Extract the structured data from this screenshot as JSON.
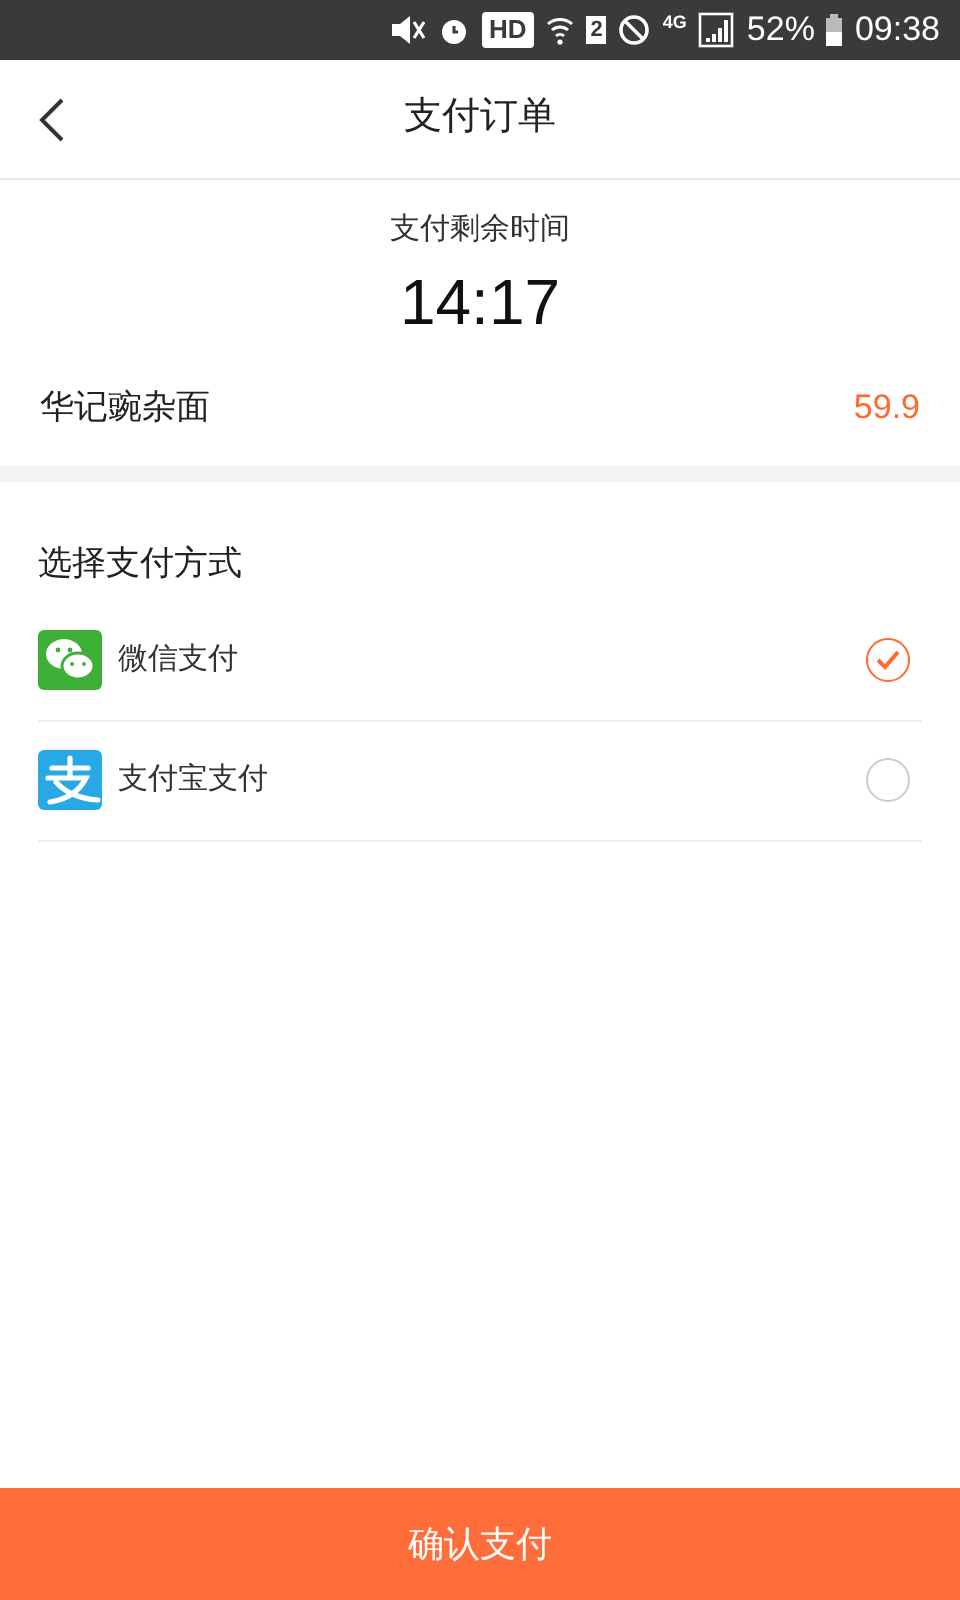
{
  "status_bar": {
    "hd_badge": "HD",
    "sim_slot": "2",
    "network": "4G",
    "battery": "52%",
    "time": "09:38"
  },
  "header": {
    "title": "支付订单"
  },
  "countdown": {
    "label": "支付剩余时间",
    "time": "14:17"
  },
  "order": {
    "name": "华记豌杂面",
    "price": "59.9"
  },
  "payment": {
    "title": "选择支付方式",
    "methods": [
      {
        "kind": "wechat",
        "label": "微信支付",
        "selected": true
      },
      {
        "kind": "alipay",
        "label": "支付宝支付",
        "selected": false
      }
    ]
  },
  "confirm_button": "确认支付"
}
